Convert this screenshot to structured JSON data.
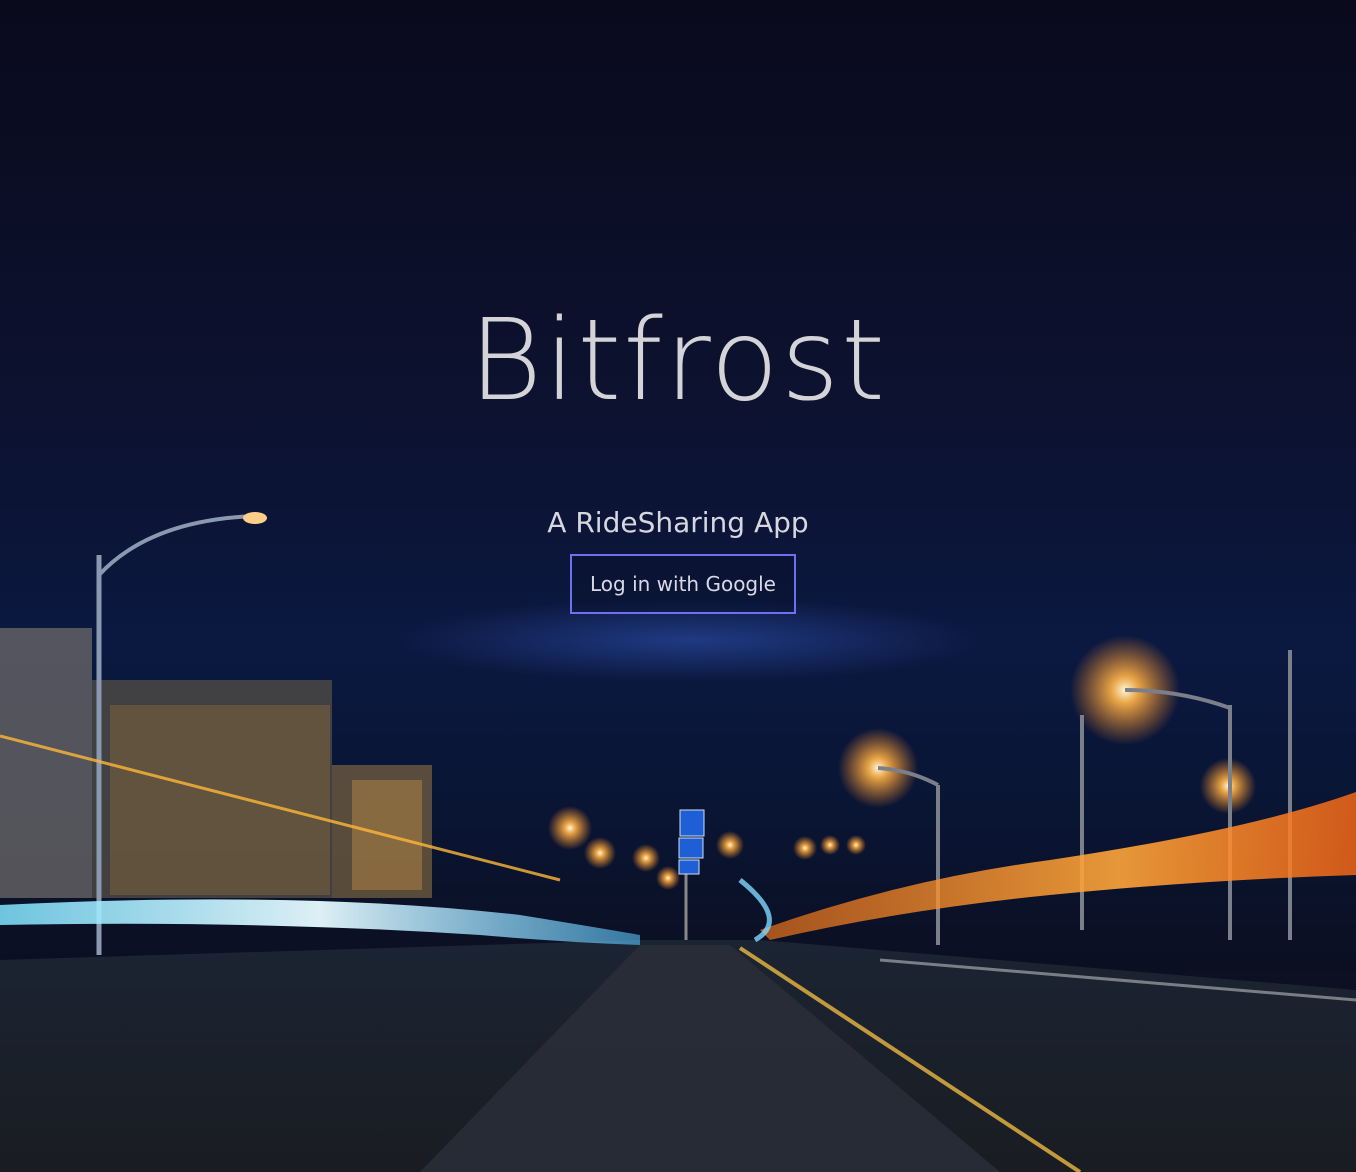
{
  "app": {
    "title": "Bitfrost",
    "tagline": "A RideSharing App"
  },
  "auth": {
    "login_label": "Log in with Google"
  },
  "colors": {
    "sky": "#0b0b1f",
    "text": "#d4d4d8",
    "button_border": "#6f6ff0",
    "trail_blue": "#bff2ff",
    "trail_orange": "#ff8a1e",
    "streetlight": "#ffb347"
  }
}
